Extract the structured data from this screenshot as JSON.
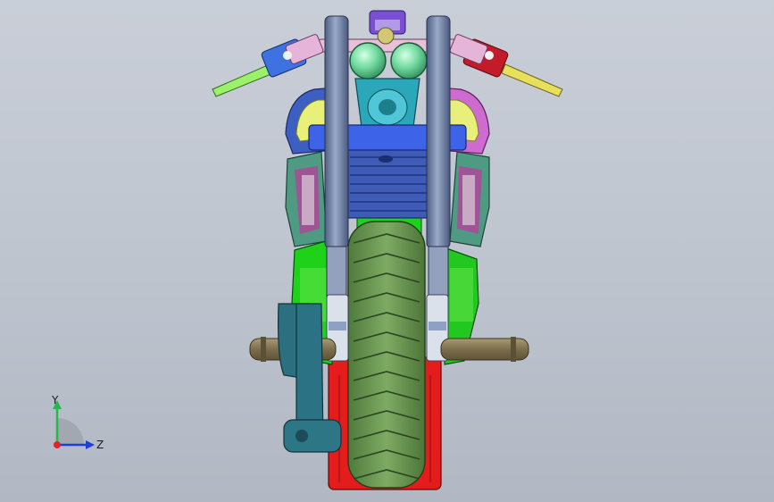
{
  "viewport": {
    "background_top": "#c9ced7",
    "background_bottom": "#b2b8c3"
  },
  "triad": {
    "y_label": "Y",
    "z_label": "Z",
    "x_color": "#e0222b",
    "y_color": "#26b64a",
    "z_color": "#1d3ed8"
  },
  "model": {
    "tire_color": "#6c9b54",
    "fork_color": "#6f82a8",
    "headlight_color": "#7fe3a8",
    "engine_green": "#16d11a",
    "brake_red": "#e41c1c",
    "fairing_yellow": "#e8f07a",
    "fairing_magenta": "#cf6ad0",
    "triple_clamp_blue": "#3c63e8"
  }
}
